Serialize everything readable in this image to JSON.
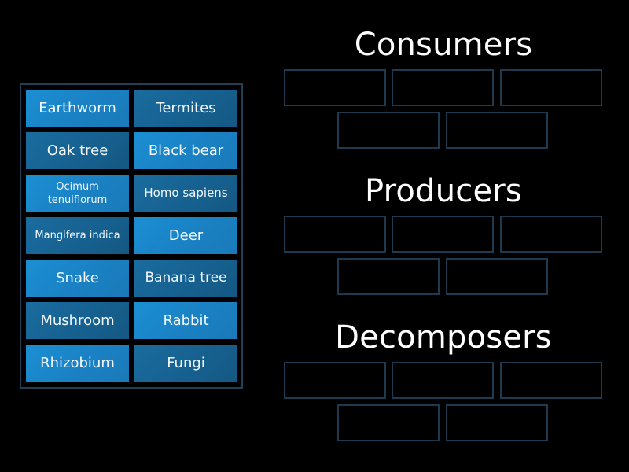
{
  "activity": "Group sort",
  "colors": {
    "background": "#000000",
    "tile_light": "#1a86c8",
    "tile_dark": "#17628f",
    "slot_border": "#1f3a4f",
    "bank_border": "#223f54",
    "text": "#ffffff"
  },
  "bank": {
    "tiles": [
      {
        "label": "Earthworm",
        "shade": "light"
      },
      {
        "label": "Termites",
        "shade": "dark"
      },
      {
        "label": "Oak tree",
        "shade": "dark"
      },
      {
        "label": "Black bear",
        "shade": "light"
      },
      {
        "label": "Ocimum tenuiflorum",
        "shade": "light"
      },
      {
        "label": "Homo sapiens",
        "shade": "dark"
      },
      {
        "label": "Mangifera indica",
        "shade": "dark"
      },
      {
        "label": "Deer",
        "shade": "light"
      },
      {
        "label": "Snake",
        "shade": "light"
      },
      {
        "label": "Banana tree",
        "shade": "dark"
      },
      {
        "label": "Mushroom",
        "shade": "dark"
      },
      {
        "label": "Rabbit",
        "shade": "light"
      },
      {
        "label": "Rhizobium",
        "shade": "light"
      },
      {
        "label": "Fungi",
        "shade": "dark"
      }
    ]
  },
  "groups": [
    {
      "title": "Consumers",
      "slots": 5
    },
    {
      "title": "Producers",
      "slots": 5
    },
    {
      "title": "Decomposers",
      "slots": 5
    }
  ]
}
